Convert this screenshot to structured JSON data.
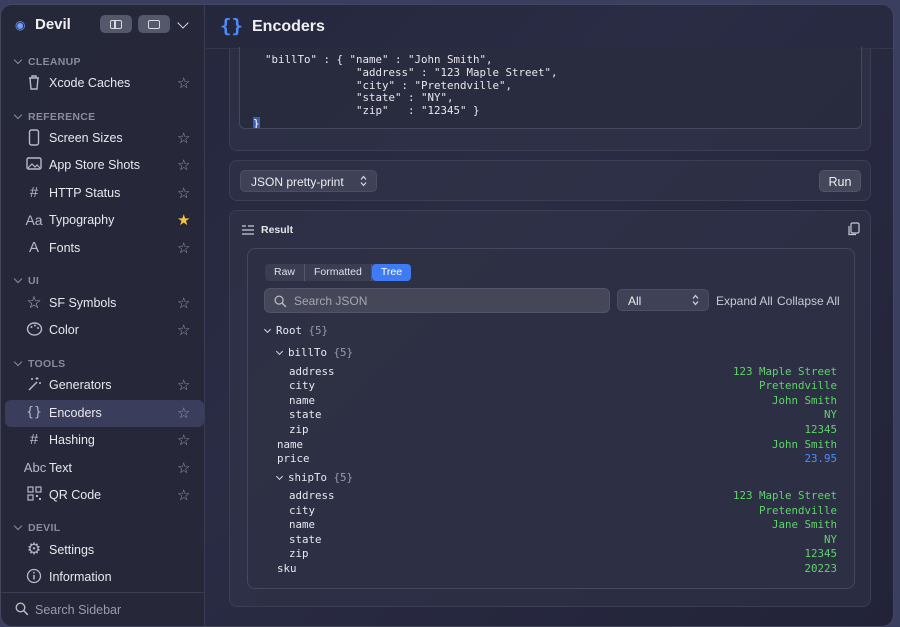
{
  "app": {
    "name": "Devil"
  },
  "sidebar": {
    "sections": [
      {
        "title": "CLEANUP",
        "items": [
          {
            "label": "Xcode Caches",
            "icon": "trash-icon",
            "favorite": false
          }
        ]
      },
      {
        "title": "REFERENCE",
        "items": [
          {
            "label": "Screen Sizes",
            "icon": "iphone-icon",
            "favorite": false
          },
          {
            "label": "App Store Shots",
            "icon": "photo-icon",
            "favorite": false
          },
          {
            "label": "HTTP Status",
            "icon": "hash-icon",
            "favorite": false
          },
          {
            "label": "Typography",
            "icon": "text-aa-icon",
            "favorite": true
          },
          {
            "label": "Fonts",
            "icon": "letter-a-icon",
            "favorite": false
          }
        ]
      },
      {
        "title": "UI",
        "items": [
          {
            "label": "SF Symbols",
            "icon": "star-outline-icon",
            "favorite": false
          },
          {
            "label": "Color",
            "icon": "palette-icon",
            "favorite": false
          }
        ]
      },
      {
        "title": "TOOLS",
        "items": [
          {
            "label": "Generators",
            "icon": "magic-wand-icon",
            "favorite": false
          },
          {
            "label": "Encoders",
            "icon": "braces-icon",
            "favorite": false,
            "active": true
          },
          {
            "label": "Hashing",
            "icon": "hash-icon",
            "favorite": false
          },
          {
            "label": "Text",
            "icon": "abc-icon",
            "favorite": false
          },
          {
            "label": "QR Code",
            "icon": "qrcode-icon",
            "favorite": false
          }
        ]
      },
      {
        "title": "DEVIL",
        "items": [
          {
            "label": "Settings",
            "icon": "gear-icon"
          },
          {
            "label": "Information",
            "icon": "info-icon"
          }
        ]
      }
    ],
    "search_placeholder": "Search Sidebar"
  },
  "main": {
    "title": "Encoders",
    "input_code": [
      "\"billTo\" : { \"name\" : \"John Smith\",",
      "              \"address\" : \"123 Maple Street\",",
      "              \"city\" : \"Pretendville\",",
      "              \"state\" : \"NY\",",
      "              \"zip\"   : \"12345\" }",
      "}"
    ],
    "mode": "JSON pretty-print",
    "run_label": "Run",
    "result": {
      "title": "Result",
      "tabs": [
        "Raw",
        "Formatted",
        "Tree"
      ],
      "active_tab": "Tree",
      "search_placeholder": "Search JSON",
      "filter": "All",
      "expand_all": "Expand All",
      "collapse_all": "Collapse All",
      "tree": {
        "root_label": "Root",
        "root_count": "{5}",
        "billTo_label": "billTo",
        "billTo_count": "{5}",
        "billTo": [
          {
            "key": "address",
            "value": "123 Maple Street"
          },
          {
            "key": "city",
            "value": "Pretendville"
          },
          {
            "key": "name",
            "value": "John Smith"
          },
          {
            "key": "state",
            "value": "NY"
          },
          {
            "key": "zip",
            "value": "12345"
          }
        ],
        "name": {
          "key": "name",
          "value": "John Smith"
        },
        "price": {
          "key": "price",
          "value": "23.95"
        },
        "shipTo_label": "shipTo",
        "shipTo_count": "{5}",
        "shipTo": [
          {
            "key": "address",
            "value": "123 Maple Street"
          },
          {
            "key": "city",
            "value": "Pretendville"
          },
          {
            "key": "name",
            "value": "Jane Smith"
          },
          {
            "key": "state",
            "value": "NY"
          },
          {
            "key": "zip",
            "value": "12345"
          }
        ],
        "sku": {
          "key": "sku",
          "value": "20223"
        }
      }
    }
  }
}
